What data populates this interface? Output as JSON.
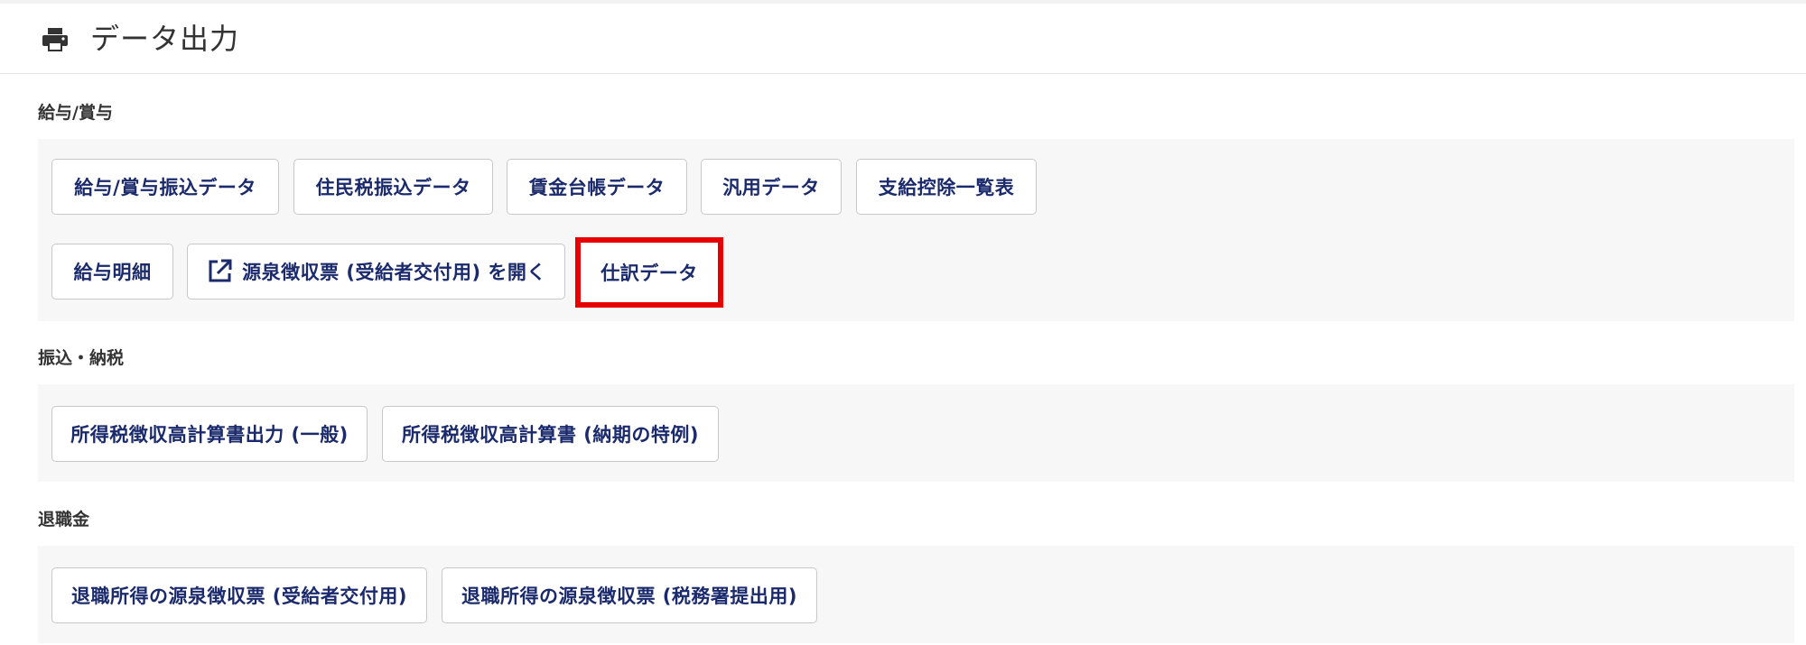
{
  "header": {
    "title": "データ出力",
    "icon": "print-icon"
  },
  "sections": [
    {
      "label": "給与/賞与",
      "buttons": [
        {
          "label": "給与/賞与振込データ"
        },
        {
          "label": "住民税振込データ"
        },
        {
          "label": "賃金台帳データ"
        },
        {
          "label": "汎用データ"
        },
        {
          "label": "支給控除一覧表"
        },
        {
          "label": "給与明細"
        },
        {
          "label": "源泉徴収票 (受給者交付用) を開く",
          "icon": "external-link-icon"
        },
        {
          "label": "仕訳データ",
          "highlighted": true
        }
      ]
    },
    {
      "label": "振込・納税",
      "buttons": [
        {
          "label": "所得税徴収高計算書出力 (一般)"
        },
        {
          "label": "所得税徴収高計算書 (納期の特例)"
        }
      ]
    },
    {
      "label": "退職金",
      "buttons": [
        {
          "label": "退職所得の源泉徴収票 (受給者交付用)"
        },
        {
          "label": "退職所得の源泉徴収票 (税務署提出用)"
        }
      ]
    }
  ],
  "colors": {
    "button_text": "#1a2a6c",
    "highlight_border": "#e80000",
    "panel_background": "#f7f7f7"
  }
}
